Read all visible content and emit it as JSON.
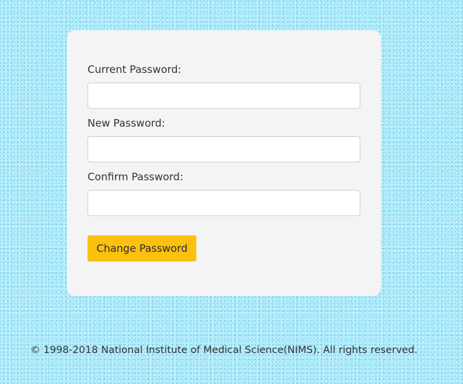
{
  "form": {
    "current_password_label": "Current Password:",
    "current_password_value": "",
    "new_password_label": "New Password:",
    "new_password_value": "",
    "confirm_password_label": "Confirm Password:",
    "confirm_password_value": "",
    "submit_label": "Change Password"
  },
  "footer": {
    "copyright": "© 1998-2018 National Institute of Medical Science(NIMS). All rights reserved."
  },
  "colors": {
    "background": "#b3ecfb",
    "card": "#f4f4f4",
    "button": "#fcc10f"
  }
}
